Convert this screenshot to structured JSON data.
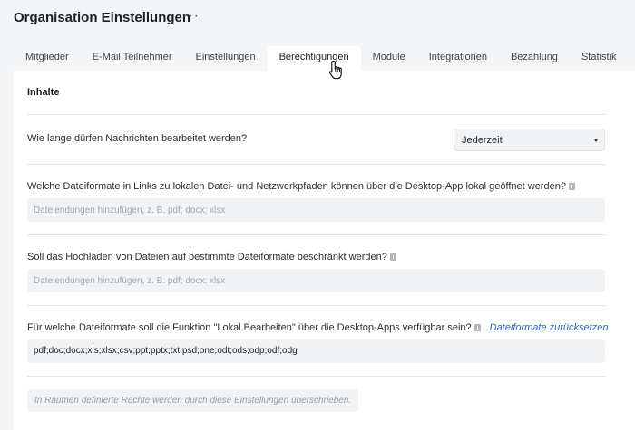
{
  "header": {
    "title": "Organisation Einstellungen",
    "more_label": "···"
  },
  "tabs": [
    {
      "label": "Mitglieder",
      "active": false
    },
    {
      "label": "E-Mail Teilnehmer",
      "active": false
    },
    {
      "label": "Einstellungen",
      "active": false
    },
    {
      "label": "Berechtigungen",
      "active": true
    },
    {
      "label": "Module",
      "active": false
    },
    {
      "label": "Integrationen",
      "active": false
    },
    {
      "label": "Bezahlung",
      "active": false
    },
    {
      "label": "Statistik",
      "active": false
    }
  ],
  "content": {
    "section_title": "Inhalte",
    "edit_question": "Wie lange dürfen Nachrichten bearbeitet werden?",
    "edit_select_value": "Jederzeit",
    "links_question": "Welche Dateiformate in Links zu lokalen Datei- und Netzwerkpfaden können über die Desktop-App lokal geöffnet werden?",
    "links_placeholder": "Dateiendungen hinzufügen, z. B. pdf; docx; xlsx",
    "upload_question": "Soll das Hochladen von Dateien auf bestimmte Dateiformate beschränkt werden?",
    "upload_placeholder": "Dateiendungen hinzufügen, z. B. pdf; docx; xlsx",
    "local_edit_question": "Für welche Dateiformate soll die Funktion \"Lokal Bearbeiten\" über die Desktop-Apps verfügbar sein?",
    "reset_link": "Dateiformate zurücksetzen",
    "local_edit_value": "pdf;doc;docx;xls;xlsx;csv;ppt;pptx;txt;psd;one;odt;ods;odp;odf;odg",
    "note": "In Räumen definierte Rechte werden durch diese Einstellungen überschrieben."
  },
  "colors": {
    "background": "#f4f5f7",
    "panel": "#ffffff",
    "link": "#2a6ab8"
  },
  "icons": {
    "more": "more-horizontal-icon",
    "info": "info-icon",
    "caret": "caret-down-icon",
    "cursor": "hand-pointer-icon"
  }
}
